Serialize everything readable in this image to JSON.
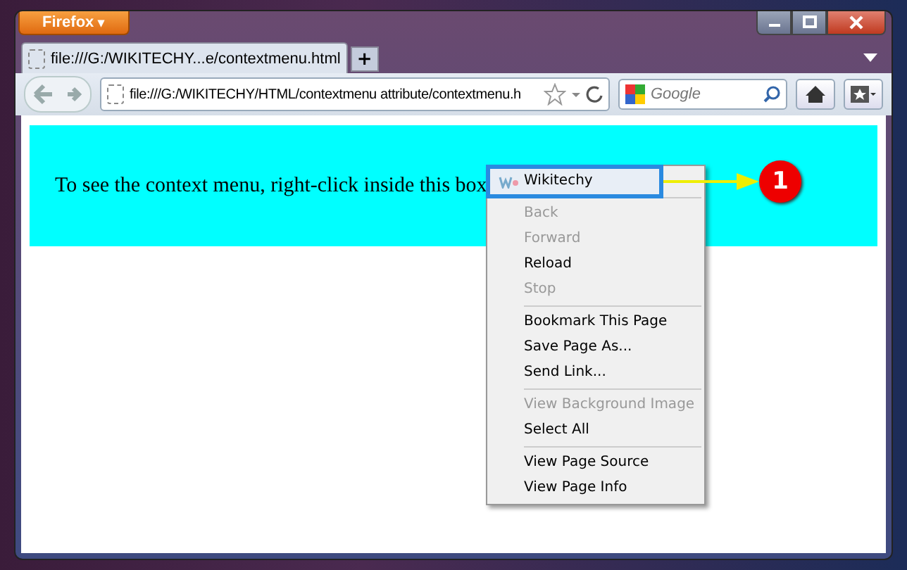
{
  "browser": {
    "app_button": "Firefox",
    "app_button_caret": "▾",
    "tabs": [
      {
        "title": "file:///G:/WIKITECHY...e/contextmenu.html",
        "selected": true
      }
    ],
    "new_tab": "+",
    "address": "file:///G:/WIKITECHY/HTML/contextmenu attribute/contextmenu.h",
    "search": {
      "placeholder": "Google"
    }
  },
  "page": {
    "box_text": "To see the context menu, right-click inside this box"
  },
  "context_menu": {
    "items": [
      {
        "kind": "custom",
        "label": "Wikitechy",
        "disabled": false,
        "highlighted": true
      },
      {
        "kind": "separator"
      },
      {
        "kind": "item",
        "label": "Back",
        "disabled": true
      },
      {
        "kind": "item",
        "label": "Forward",
        "disabled": true
      },
      {
        "kind": "item",
        "label": "Reload",
        "disabled": false
      },
      {
        "kind": "item",
        "label": "Stop",
        "disabled": true
      },
      {
        "kind": "separator"
      },
      {
        "kind": "item",
        "label": "Bookmark This Page",
        "disabled": false
      },
      {
        "kind": "item",
        "label": "Save Page As...",
        "disabled": false
      },
      {
        "kind": "item",
        "label": "Send Link...",
        "disabled": false
      },
      {
        "kind": "separator"
      },
      {
        "kind": "item",
        "label": "View Background Image",
        "disabled": true
      },
      {
        "kind": "item",
        "label": "Select All",
        "disabled": false
      },
      {
        "kind": "separator"
      },
      {
        "kind": "item",
        "label": "View Page Source",
        "disabled": false
      },
      {
        "kind": "item",
        "label": "View Page Info",
        "disabled": false
      }
    ]
  },
  "callout": {
    "number": "1"
  }
}
